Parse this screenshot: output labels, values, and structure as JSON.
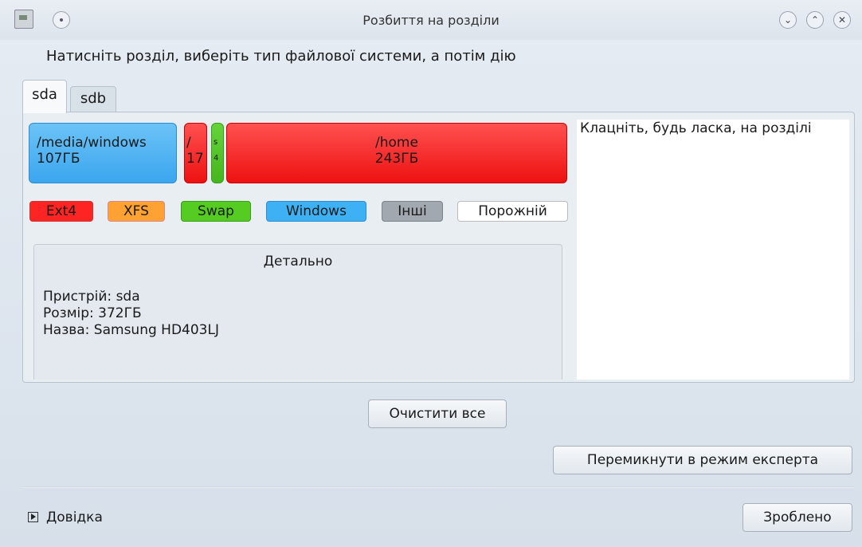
{
  "window": {
    "title": "Розбиття на розділи"
  },
  "instruction": "Натисніть розділ, виберіть тип файлової системи, а потім дію",
  "tabs": [
    {
      "label": "sda"
    },
    {
      "label": "sdb"
    }
  ],
  "partitions": [
    {
      "name": "/media/windows",
      "size": "107ГБ",
      "fs": "Windows",
      "color": "#3ba6ef"
    },
    {
      "name": "/",
      "size": "17",
      "fs": "Ext4",
      "color": "#ee1111"
    },
    {
      "name": "s",
      "size": "4",
      "fs": "Swap",
      "color": "#46b61e"
    },
    {
      "name": "/home",
      "size": "243ГБ",
      "fs": "Ext4",
      "color": "#ee1111"
    }
  ],
  "legend": [
    {
      "label": "Ext4",
      "color": "#ff2424"
    },
    {
      "label": "XFS",
      "color": "#ffa133"
    },
    {
      "label": "Swap",
      "color": "#55cc22"
    },
    {
      "label": "Windows",
      "color": "#3eb1f5"
    },
    {
      "label": "Інші",
      "color": "#a2a8b0"
    },
    {
      "label": "Порожній",
      "color": "#ffffff"
    }
  ],
  "details": {
    "title": "Детально",
    "device": "Пристрій: sda",
    "size": "Розмір: 372ГБ",
    "name": "Назва: Samsung HD403LJ"
  },
  "info_text": "Клацніть, будь ласка, на розділі",
  "buttons": {
    "clear_all": "Очистити все",
    "expert_mode": "Перемикнути в режим експерта",
    "done": "Зроблено",
    "help": "Довідка"
  }
}
